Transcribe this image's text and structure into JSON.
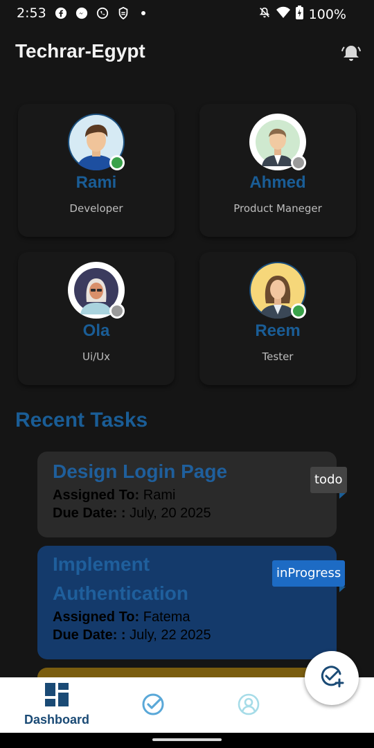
{
  "status_bar": {
    "time": "2:53",
    "app_icons": [
      "facebook-icon",
      "messenger-icon",
      "whatsapp-icon",
      "app-icon"
    ],
    "battery": "100%"
  },
  "app_bar": {
    "title": "Techrar-Egypt",
    "notification_icon": "bell-icon"
  },
  "team": [
    {
      "name": "Rami",
      "role": "Developer",
      "status": "online"
    },
    {
      "name": "Ahmed",
      "role": "Product Maneger",
      "status": "offline"
    },
    {
      "name": "Ola",
      "role": "Ui/Ux",
      "status": "offline"
    },
    {
      "name": "Reem",
      "role": "Tester",
      "status": "online"
    }
  ],
  "recent_tasks": {
    "title": "Recent Tasks",
    "tasks": [
      {
        "title": "Design Login Page",
        "assigned_label": "Assigned To:",
        "assigned_to": "Rami",
        "due_label": "Due Date: :",
        "due_date": "July, 20 2025",
        "status": "todo"
      },
      {
        "title": "Implement Authentication",
        "assigned_label": "Assigned To:",
        "assigned_to": "Fatema",
        "due_label": "Due Date: :",
        "due_date": "July, 22 2025",
        "status": "inProgress"
      }
    ]
  },
  "bottom_nav": {
    "items": [
      {
        "label": "Dashboard",
        "icon": "dashboard-icon",
        "active": true
      },
      {
        "label": "",
        "icon": "tasks-check-icon",
        "active": false
      },
      {
        "label": "",
        "icon": "profile-icon",
        "active": false
      }
    ]
  },
  "fab": {
    "icon": "add-task-icon"
  },
  "colors": {
    "background": "#151515",
    "accent": "#1a5d96",
    "todo_card": "#2a2a2a",
    "in_progress_card": "#143a6b",
    "done_card": "#7a5d0f",
    "online": "#3aa24a",
    "offline": "#9a9a9a"
  }
}
